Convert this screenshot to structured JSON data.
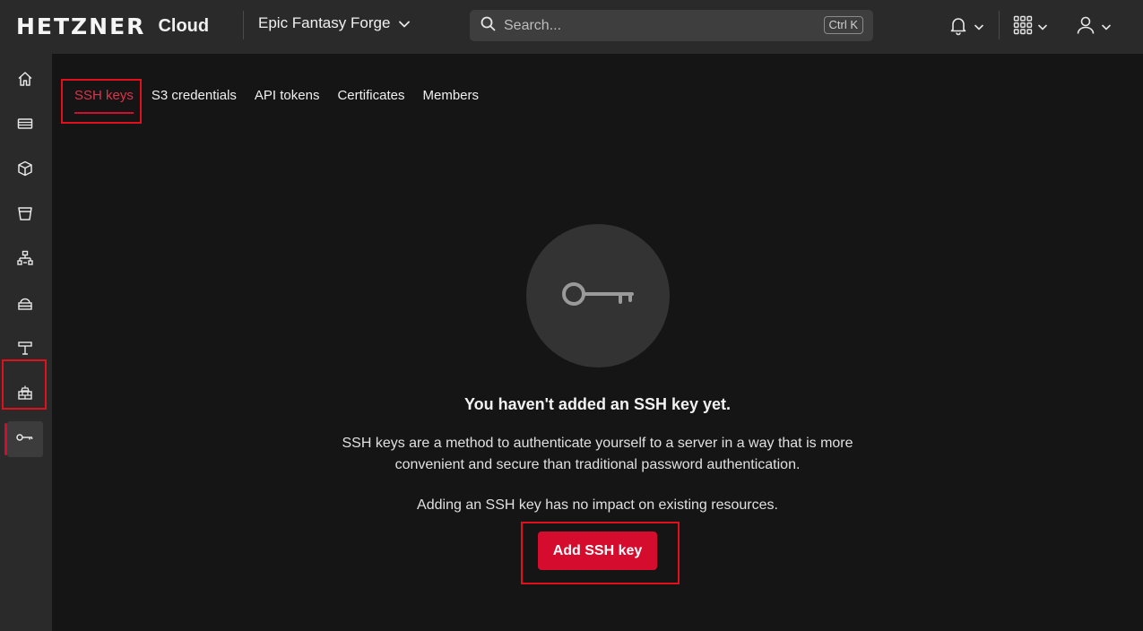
{
  "header": {
    "logo_text": "HETZNER",
    "logo_sub": "Cloud",
    "project_name": "Epic Fantasy Forge",
    "search_placeholder": "Search...",
    "search_shortcut": "Ctrl K",
    "icons": [
      "bell-icon",
      "apps-grid-icon",
      "user-icon"
    ]
  },
  "sidebar": {
    "items": [
      {
        "name": "home",
        "icon": "home-icon"
      },
      {
        "name": "servers",
        "icon": "server-icon"
      },
      {
        "name": "volumes",
        "icon": "cube-icon"
      },
      {
        "name": "storage",
        "icon": "bucket-icon"
      },
      {
        "name": "networks",
        "icon": "network-icon"
      },
      {
        "name": "load-balancers",
        "icon": "cloud-stack-icon"
      },
      {
        "name": "floating-ips",
        "icon": "signpost-icon"
      },
      {
        "name": "firewalls",
        "icon": "firewall-icon"
      },
      {
        "name": "security",
        "icon": "key-icon",
        "active": true
      }
    ]
  },
  "tabs": [
    {
      "label": "SSH keys",
      "active": true
    },
    {
      "label": "S3 credentials"
    },
    {
      "label": "API tokens"
    },
    {
      "label": "Certificates"
    },
    {
      "label": "Members"
    }
  ],
  "empty_state": {
    "icon": "key-icon",
    "title": "You haven't added an SSH key yet.",
    "description_line1": "SSH keys are a method to authenticate yourself to a server in a way that is more",
    "description_line2": "convenient and secure than traditional password authentication.",
    "note": "Adding an SSH key has no impact on existing resources.",
    "button_label": "Add SSH key"
  },
  "colors": {
    "accent": "#d50c2d",
    "background": "#151515",
    "panel": "#2a2a2a"
  }
}
